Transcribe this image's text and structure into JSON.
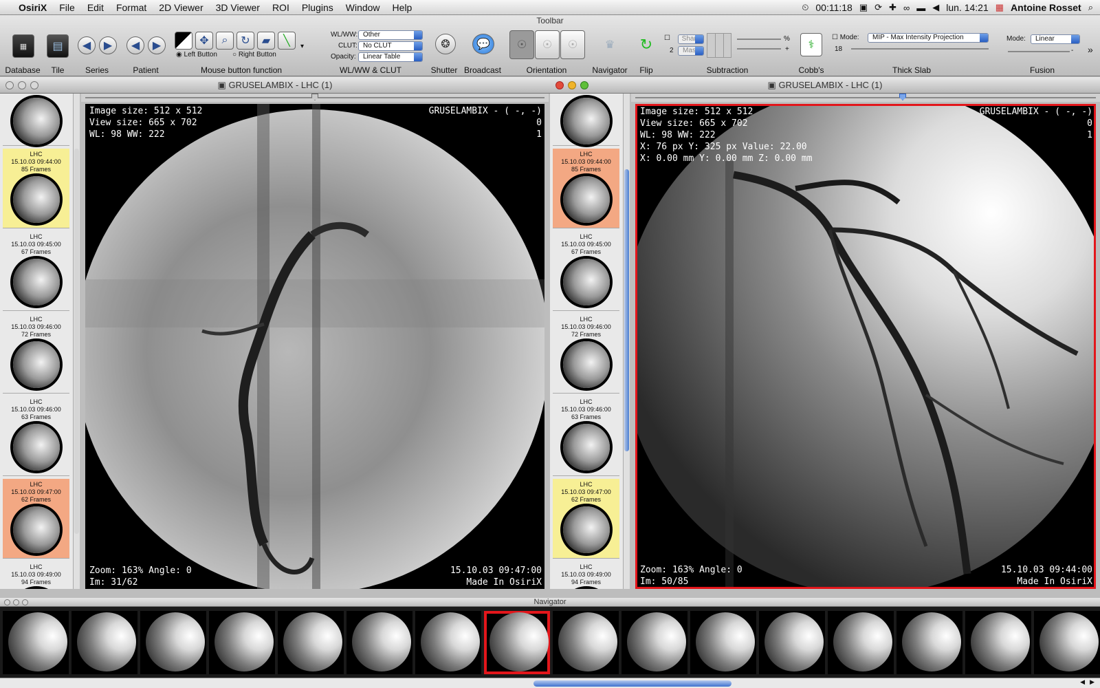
{
  "menubar": {
    "apple": "",
    "items": [
      "OsiriX",
      "File",
      "Edit",
      "Format",
      "2D Viewer",
      "3D Viewer",
      "ROI",
      "Plugins",
      "Window",
      "Help"
    ],
    "clock": "00:11:18",
    "datetime": "lun. 14:21",
    "user": "Antoine Rosset"
  },
  "toolbar": {
    "title": "Toolbar",
    "labels": {
      "database": "Database",
      "tile": "Tile",
      "series": "Series",
      "patient": "Patient",
      "mouse": "Mouse button function",
      "wlww_clut": "WL/WW & CLUT",
      "shutter": "Shutter",
      "broadcast": "Broadcast",
      "orientation": "Orientation",
      "navigator": "Navigator",
      "flip": "Flip",
      "subtraction": "Subtraction",
      "cobbs": "Cobb's",
      "thickslab": "Thick Slab",
      "fusion": "Fusion"
    },
    "left_button": "Left Button",
    "right_button": "Right Button",
    "wlww_label": "WL/WW:",
    "wlww_value": "Other",
    "clut_label": "CLUT:",
    "clut_value": "No CLUT",
    "opacity_label": "Opacity:",
    "opacity_value": "Linear Table",
    "sharp": "Sharp",
    "mask": "Mask",
    "sub_num": "2",
    "percent": "%",
    "minus": "-",
    "plus": "+",
    "slab_mode_label": "Mode:",
    "slab_mode_value": "MIP - Max Intensity Projection",
    "slab_num": "18",
    "fusion_mode_label": "Mode:",
    "fusion_mode_value": "Linear",
    "more": "»"
  },
  "left_window": {
    "title": "GRUSELAMBIX - LHC (1)",
    "overlay": {
      "line1": "Image size: 512 x 512",
      "line2": "View size: 665 x 702",
      "line3": "WL: 98 WW: 222",
      "patient": "GRUSELAMBIX - ( -, -)",
      "r1": "0",
      "r2": "1",
      "zoom": "Zoom: 163% Angle: 0",
      "im": "Im: 31/62",
      "date": "15.10.03 09:47:00",
      "made": "Made In OsiriX"
    }
  },
  "right_window": {
    "title": "GRUSELAMBIX - LHC (1)",
    "overlay": {
      "line1": "Image size: 512 x 512",
      "line2": "View size: 665 x 702",
      "line3": "WL: 98 WW: 222",
      "line4": "X: 76 px Y: 325 px Value: 22.00",
      "line5": "X: 0.00 mm Y: 0.00 mm Z: 0.00 mm",
      "patient": "GRUSELAMBIX - ( -, -)",
      "r1": "0",
      "r2": "1",
      "zoom": "Zoom: 163% Angle: 0",
      "im": "Im: 50/85",
      "date": "15.10.03 09:44:00",
      "made": "Made In OsiriX"
    }
  },
  "series_left": [
    {
      "name": "LHC",
      "date": "15.10.03 09:44:00",
      "frames": "85 Frames",
      "color": "#f7ef95"
    },
    {
      "name": "LHC",
      "date": "15.10.03 09:45:00",
      "frames": "67 Frames",
      "color": "#e9e9e9"
    },
    {
      "name": "LHC",
      "date": "15.10.03 09:46:00",
      "frames": "72 Frames",
      "color": "#e9e9e9"
    },
    {
      "name": "LHC",
      "date": "15.10.03 09:46:00",
      "frames": "63 Frames",
      "color": "#e9e9e9"
    },
    {
      "name": "LHC",
      "date": "15.10.03 09:47:00",
      "frames": "62 Frames",
      "color": "#f3a883"
    },
    {
      "name": "LHC",
      "date": "15.10.03 09:49:00",
      "frames": "94 Frames",
      "color": "#e9e9e9"
    }
  ],
  "series_right": [
    {
      "name": "LHC",
      "date": "15.10.03 09:44:00",
      "frames": "85 Frames",
      "color": "#f3a883"
    },
    {
      "name": "LHC",
      "date": "15.10.03 09:45:00",
      "frames": "67 Frames",
      "color": "#e9e9e9"
    },
    {
      "name": "LHC",
      "date": "15.10.03 09:46:00",
      "frames": "72 Frames",
      "color": "#e9e9e9"
    },
    {
      "name": "LHC",
      "date": "15.10.03 09:46:00",
      "frames": "63 Frames",
      "color": "#e9e9e9"
    },
    {
      "name": "LHC",
      "date": "15.10.03 09:47:00",
      "frames": "62 Frames",
      "color": "#f7ef95"
    },
    {
      "name": "LHC",
      "date": "15.10.03 09:49:00",
      "frames": "94 Frames",
      "color": "#e9e9e9"
    }
  ],
  "navigator": {
    "title": "Navigator",
    "frame_count": 16,
    "selected_index": 7,
    "selection_color": "#e3161b"
  },
  "colors": {
    "selection_border": "#e3161b",
    "accent": "#3f72cf"
  }
}
